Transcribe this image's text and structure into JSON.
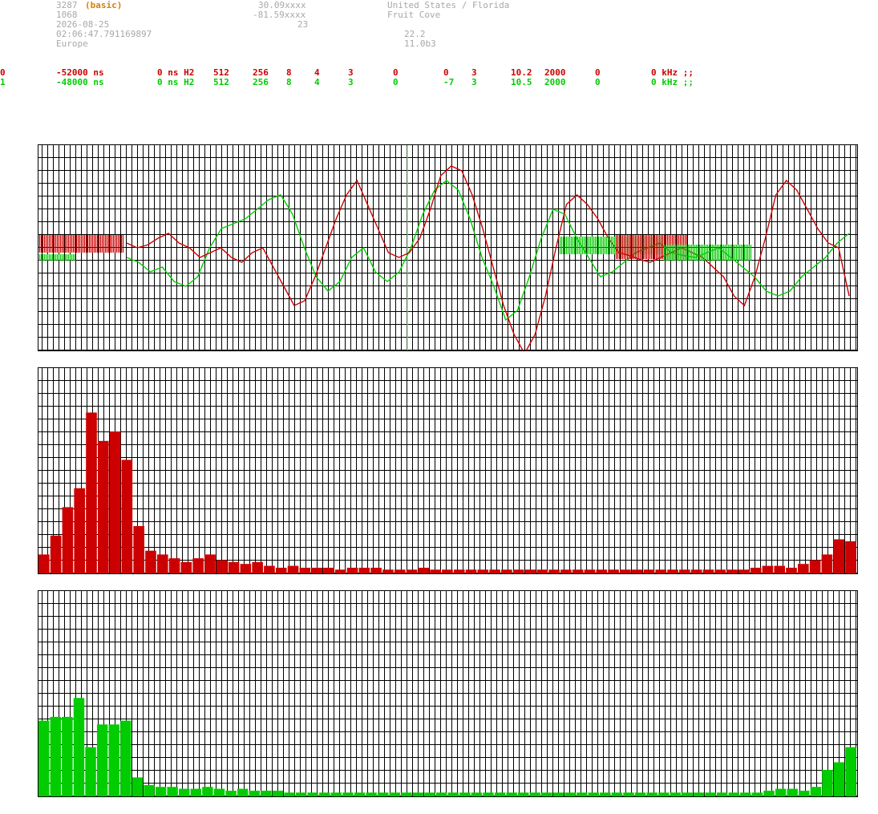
{
  "header": {
    "station_id": "3287",
    "mode": "(basic)",
    "code": "1068",
    "date": "2026-08-25",
    "time": "02:06:47.791169897",
    "region": "Europe",
    "latitude": "30.09xxxx",
    "longitude": "-81.59xxxx",
    "altitude": "23",
    "country": "United States / Florida",
    "city": "Fruit Cove",
    "value1": "22.2",
    "value2": "11.0b3"
  },
  "colors": {
    "channel0": "#cc0000",
    "channel1": "#00cc00",
    "grid": "#000000",
    "header_gray": "#a8a8a8",
    "mode_orange": "#d88000"
  },
  "channels": [
    {
      "c1": "0",
      "c2": "-52000 ns",
      "c3": "0 ns H2",
      "c4": "512",
      "c5": "256",
      "c6": "8",
      "c7": "4",
      "c8": "3",
      "c9": "0",
      "c10": "0",
      "c11": "3",
      "c12": "10.2",
      "c13": "2000",
      "c14": "0",
      "c15": "0 kHz ;;"
    },
    {
      "c1": "1",
      "c2": "-48000 ns",
      "c3": "0 ns H2",
      "c4": "512",
      "c5": "256",
      "c6": "8",
      "c7": "4",
      "c8": "3",
      "c9": "0",
      "c10": "-7",
      "c11": "3",
      "c12": "10.5",
      "c13": "2000",
      "c14": "0",
      "c15": "0 kHz ;;"
    }
  ],
  "chart_data": [
    {
      "type": "line",
      "series": [
        {
          "values": [
            0.05,
            0.0,
            0.03,
            0.1,
            0.15,
            0.05,
            0.0,
            -0.1,
            -0.05,
            0.0,
            -0.1,
            -0.15,
            -0.05,
            0.0,
            -0.2,
            -0.4,
            -0.6,
            -0.55,
            -0.3,
            0.0,
            0.3,
            0.55,
            0.7,
            0.45,
            0.2,
            -0.05,
            -0.1,
            -0.05,
            0.1,
            0.4,
            0.75,
            0.85,
            0.8,
            0.55,
            0.2,
            -0.2,
            -0.6,
            -0.9,
            -1.1,
            -0.9,
            -0.5,
            0.0,
            0.45,
            0.55,
            0.45,
            0.3,
            0.1,
            -0.05,
            -0.08,
            -0.12,
            -0.15,
            -0.1,
            -0.05,
            0.0,
            -0.05,
            -0.1,
            -0.2,
            -0.3,
            -0.5,
            -0.6,
            -0.3,
            0.1,
            0.55,
            0.7,
            0.6,
            0.4,
            0.2,
            0.05,
            0.0,
            -0.5
          ]
        },
        {
          "values": [
            -0.1,
            -0.15,
            -0.25,
            -0.2,
            -0.35,
            -0.4,
            -0.3,
            0.0,
            0.2,
            0.25,
            0.3,
            0.4,
            0.5,
            0.55,
            0.35,
            0.0,
            -0.3,
            -0.45,
            -0.35,
            -0.1,
            0.0,
            -0.25,
            -0.35,
            -0.25,
            0.0,
            0.35,
            0.6,
            0.7,
            0.6,
            0.3,
            -0.1,
            -0.4,
            -0.75,
            -0.65,
            -0.3,
            0.1,
            0.4,
            0.35,
            0.1,
            -0.1,
            -0.3,
            -0.25,
            -0.15,
            -0.05,
            0.0,
            0.05,
            -0.05,
            -0.08,
            -0.1,
            -0.05,
            0.0,
            -0.1,
            -0.2,
            -0.3,
            -0.45,
            -0.5,
            -0.45,
            -0.3,
            -0.2,
            -0.1,
            0.05,
            0.15
          ]
        }
      ],
      "ylim": [
        -1,
        1
      ]
    },
    {
      "type": "bar",
      "values": [
        10,
        20,
        35,
        45,
        85,
        70,
        75,
        60,
        25,
        12,
        10,
        8,
        6,
        8,
        10,
        7,
        6,
        5,
        6,
        4,
        3,
        4,
        3,
        3,
        3,
        2,
        3,
        3,
        3,
        2,
        2,
        2,
        3,
        2,
        2,
        2,
        2,
        2,
        2,
        2,
        2,
        2,
        2,
        2,
        2,
        2,
        2,
        2,
        2,
        2,
        2,
        2,
        2,
        2,
        2,
        2,
        2,
        2,
        2,
        2,
        3,
        4,
        4,
        3,
        5,
        7,
        10,
        18,
        17
      ]
    },
    {
      "type": "bar",
      "values": [
        40,
        42,
        42,
        52,
        26,
        38,
        38,
        40,
        10,
        6,
        5,
        5,
        4,
        4,
        5,
        4,
        3,
        4,
        3,
        3,
        3,
        2,
        2,
        2,
        2,
        2,
        2,
        2,
        2,
        2,
        2,
        2,
        2,
        2,
        2,
        2,
        2,
        2,
        2,
        2,
        2,
        2,
        2,
        2,
        2,
        2,
        2,
        2,
        2,
        2,
        2,
        2,
        2,
        2,
        2,
        2,
        2,
        2,
        2,
        2,
        2,
        2,
        3,
        4,
        4,
        3,
        5,
        14,
        18,
        26
      ]
    }
  ]
}
